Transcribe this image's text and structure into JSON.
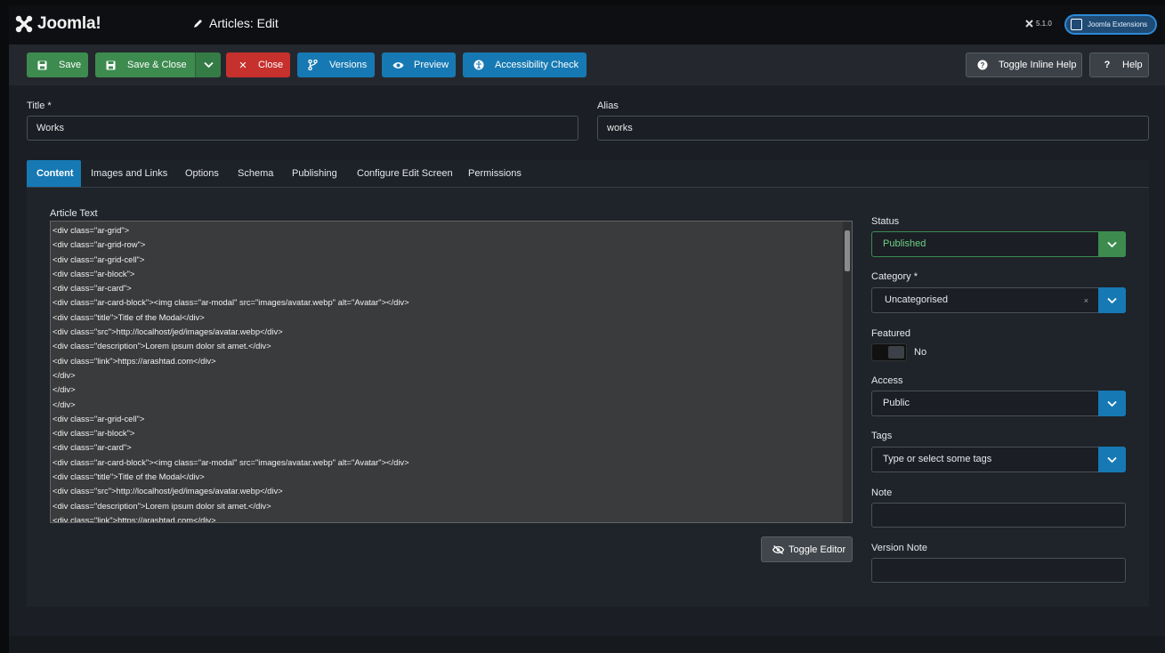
{
  "header": {
    "logo_text": "Joomla!",
    "page_title": "Articles: Edit",
    "version": "5.1.0",
    "extensions_label": "Joomla Extensions"
  },
  "toolbar": {
    "save": "Save",
    "save_close": "Save & Close",
    "close": "Close",
    "versions": "Versions",
    "preview": "Preview",
    "accessibility": "Accessibility Check",
    "toggle_help": "Toggle Inline Help",
    "help": "Help"
  },
  "fields": {
    "title_label": "Title *",
    "title_value": "Works",
    "alias_label": "Alias",
    "alias_value": "works"
  },
  "tabs": [
    {
      "label": "Content"
    },
    {
      "label": "Images and Links"
    },
    {
      "label": "Options"
    },
    {
      "label": "Schema"
    },
    {
      "label": "Publishing"
    },
    {
      "label": "Configure Edit Screen"
    },
    {
      "label": "Permissions"
    }
  ],
  "content": {
    "article_text_label": "Article Text",
    "editor_lines": [
      "<div class=\"ar-grid\">",
      "<div class=\"ar-grid-row\">",
      "<div class=\"ar-grid-cell\">",
      "<div class=\"ar-block\">",
      "<div class=\"ar-card\">",
      "<div class=\"ar-card-block\"><img class=\"ar-modal\" src=\"images/avatar.webp\" alt=\"Avatar\"></div>",
      "<div class=\"title\">Title of the Modal</div>",
      "<div class=\"src\">http://localhost/jed/images/avatar.webp</div>",
      "<div class=\"description\">Lorem ipsum dolor sit amet.</div>",
      "<div class=\"link\">https://arashtad.com</div>",
      "</div>",
      "</div>",
      "</div>",
      "<div class=\"ar-grid-cell\">",
      "<div class=\"ar-block\">",
      "<div class=\"ar-card\">",
      "<div class=\"ar-card-block\"><img class=\"ar-modal\" src=\"images/avatar.webp\" alt=\"Avatar\"></div>",
      "<div class=\"title\">Title of the Modal</div>",
      "<div class=\"src\">http://localhost/jed/images/avatar.webp</div>",
      "<div class=\"description\">Lorem ipsum dolor sit amet.</div>",
      "<div class=\"link\">https://arashtad.com</div>"
    ],
    "toggle_editor": "Toggle Editor"
  },
  "sidebar": {
    "status_label": "Status",
    "status_value": "Published",
    "category_label": "Category *",
    "category_value": "Uncategorised",
    "category_clear": "×",
    "featured_label": "Featured",
    "featured_value": "No",
    "access_label": "Access",
    "access_value": "Public",
    "tags_label": "Tags",
    "tags_placeholder": "Type or select some tags",
    "note_label": "Note",
    "version_note_label": "Version Note"
  }
}
